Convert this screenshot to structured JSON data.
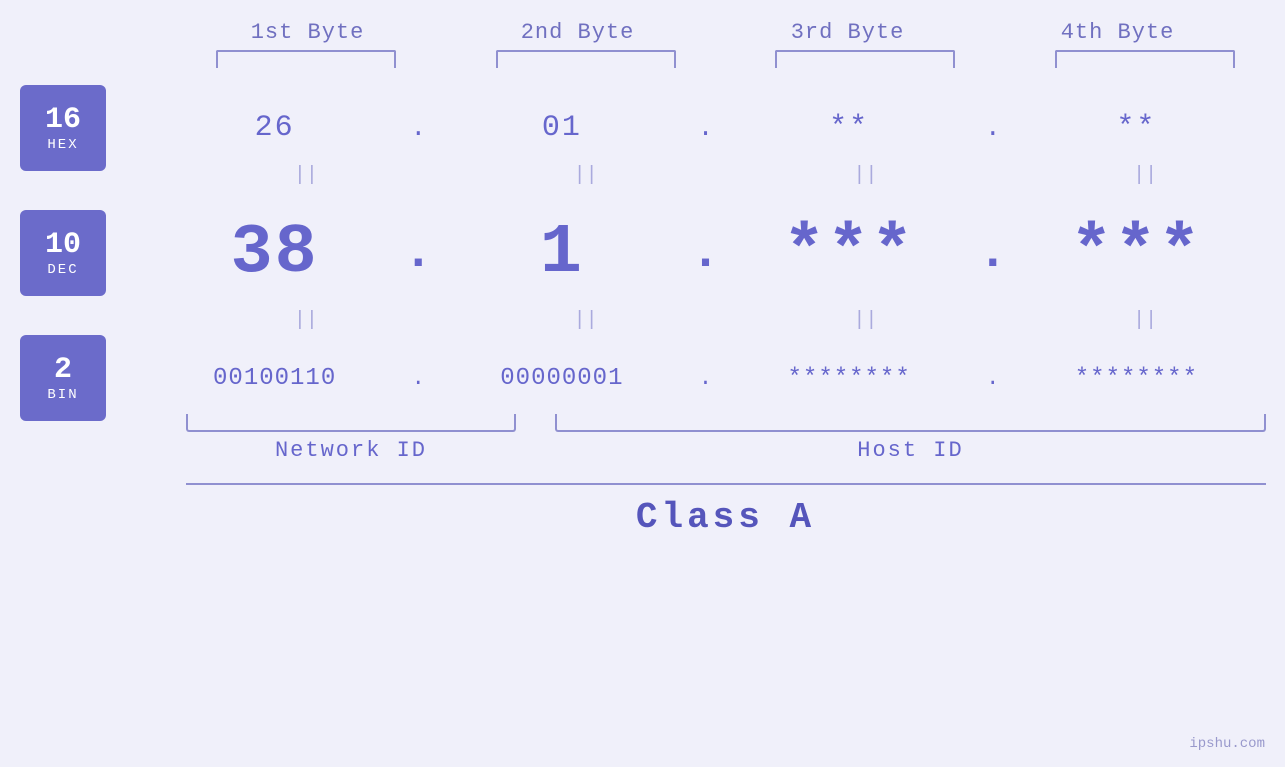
{
  "colors": {
    "background": "#f0f0fa",
    "accent": "#6666cc",
    "badge": "#6b6bca",
    "bracket": "#9090d0",
    "text_main": "#6666cc",
    "text_muted": "#9999cc",
    "equals": "#aaaadd"
  },
  "byte_headers": {
    "b1": "1st Byte",
    "b2": "2nd Byte",
    "b3": "3rd Byte",
    "b4": "4th Byte"
  },
  "bases": {
    "hex": {
      "number": "16",
      "label": "HEX"
    },
    "dec": {
      "number": "10",
      "label": "DEC"
    },
    "bin": {
      "number": "2",
      "label": "BIN"
    }
  },
  "hex_row": {
    "b1": "26",
    "b2": "01",
    "b3": "**",
    "b4": "**",
    "dot": "."
  },
  "dec_row": {
    "b1": "38",
    "b2": "1",
    "b3": "***",
    "b4": "***",
    "dot": "."
  },
  "bin_row": {
    "b1": "00100110",
    "b2": "00000001",
    "b3": "********",
    "b4": "********",
    "dot": "."
  },
  "labels": {
    "network_id": "Network ID",
    "host_id": "Host ID",
    "class": "Class A"
  },
  "equals_symbol": "||",
  "watermark": "ipshu.com"
}
